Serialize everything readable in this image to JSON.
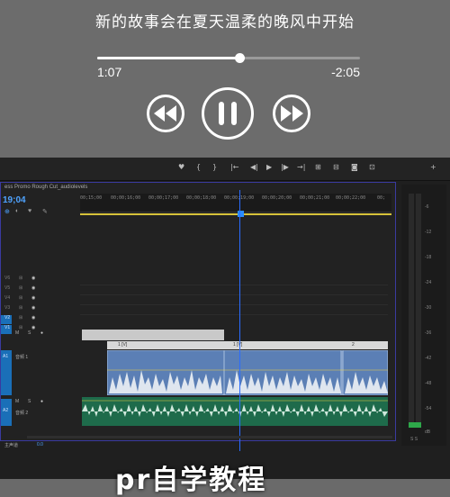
{
  "player": {
    "song_title": "新的故事会在夏天温柔的晚风中开始",
    "elapsed": "1:07",
    "remaining": "-2:05",
    "progress_fraction": 0.54
  },
  "editor": {
    "sequence_tab": "ess Promo Rough Cut_audiolevels",
    "timecode": "19;04",
    "ruler_ticks": [
      "00;15;00",
      "00;00;16;00",
      "00;00;17;00",
      "00;00;18;00",
      "00;00;19;00",
      "00;00;20;00",
      "00;00;21;00",
      "00;00;22;00",
      "00;"
    ],
    "video_tracks": [
      "V6",
      "V5",
      "V4",
      "V3",
      "V2",
      "V1"
    ],
    "audio_tracks": [
      {
        "id": "A1",
        "name": "音频 1"
      },
      {
        "id": "A2",
        "name": "音频 2"
      }
    ],
    "master_label": "主声道",
    "master_value": "0.0",
    "clip_labels": [
      "1 [V]",
      "1 [V]",
      "2"
    ],
    "meter_db": [
      "-6",
      "-12",
      "-18",
      "-24",
      "-30",
      "-36",
      "-42",
      "-48",
      "-54",
      "dB"
    ],
    "meter_footer": "S S"
  },
  "caption": "pr自学教程"
}
